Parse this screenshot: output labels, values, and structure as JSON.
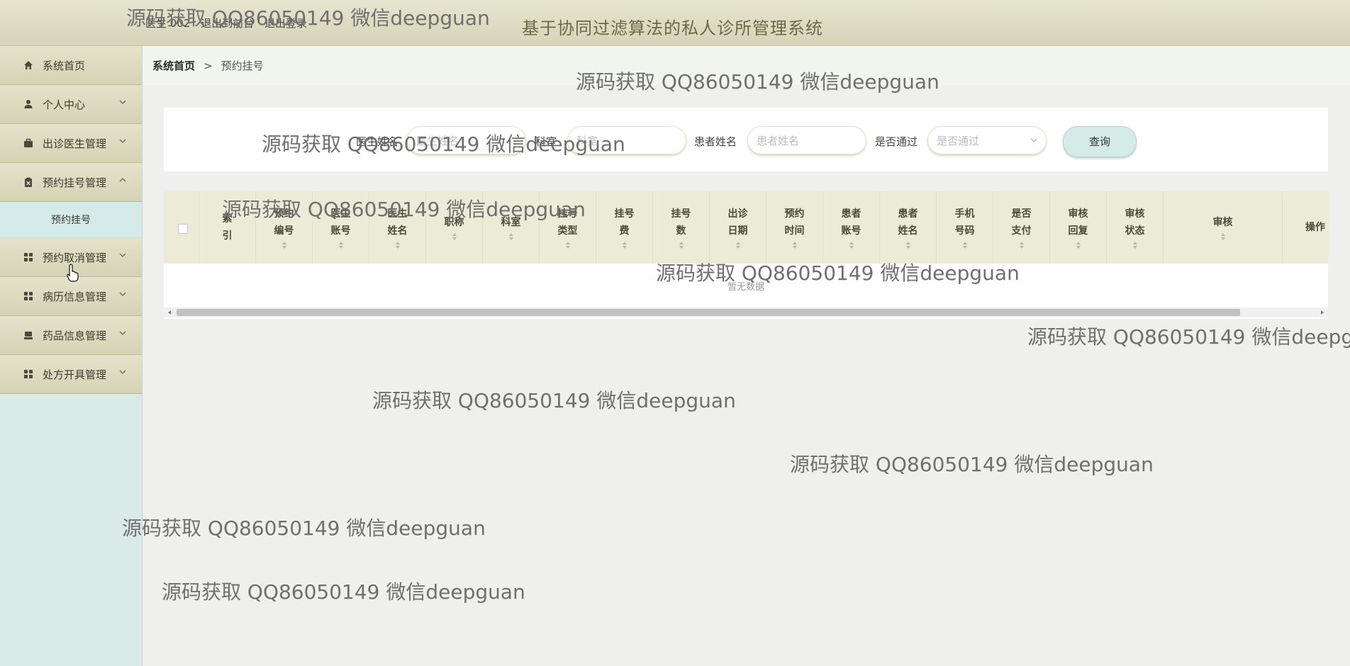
{
  "header": {
    "user_label": "医生 002",
    "front_link": "退出到前台",
    "logout_link": "退出登录",
    "system_title": "基于协同过滤算法的私人诊所管理系统"
  },
  "sidebar": {
    "items": [
      {
        "label": "系统首页",
        "icon": "home-icon"
      },
      {
        "label": "个人中心",
        "icon": "user-icon"
      },
      {
        "label": "出诊医生管理",
        "icon": "briefcase-icon"
      },
      {
        "label": "预约挂号管理",
        "icon": "clipboard-icon",
        "expanded": true,
        "sub": [
          "预约挂号"
        ]
      },
      {
        "label": "预约取消管理",
        "icon": "grid-icon"
      },
      {
        "label": "病历信息管理",
        "icon": "grid-icon"
      },
      {
        "label": "药品信息管理",
        "icon": "box-icon"
      },
      {
        "label": "处方开具管理",
        "icon": "grid-icon"
      }
    ]
  },
  "breadcrumb": {
    "home": "系统首页",
    "separator": ">",
    "current": "预约挂号"
  },
  "search": {
    "doctor_name_label": "医生姓名",
    "doctor_name_placeholder": "医生姓名",
    "dept_label": "科室",
    "dept_placeholder": "科室",
    "patient_name_label": "患者姓名",
    "patient_name_placeholder": "患者姓名",
    "approved_label": "是否通过",
    "approved_placeholder": "是否通过",
    "query_button": "查询"
  },
  "table": {
    "columns": [
      "索\n引",
      "预约\n编号",
      "医生\n账号",
      "医生\n姓名",
      "职称",
      "科室",
      "挂号\n类型",
      "挂号\n费",
      "挂号\n数",
      "出诊\n日期",
      "预约\n时间",
      "患者\n账号",
      "患者\n姓名",
      "手机\n号码",
      "是否\n支付",
      "审核\n回复",
      "审核\n状态",
      "审核",
      "操作"
    ],
    "empty_text": "暂无数据"
  },
  "watermark": "源码获取 QQ86050149 微信deepguan"
}
